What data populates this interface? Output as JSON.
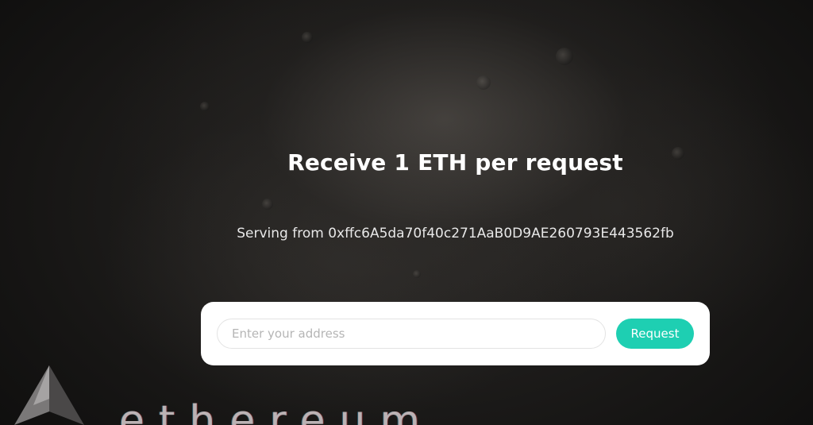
{
  "hero": {
    "title": "Receive 1 ETH per request",
    "serving_text": "Serving from 0xffc6A5da70f40c271AaB0D9AE260793E443562fb"
  },
  "form": {
    "address_placeholder": "Enter your address",
    "address_value": "",
    "request_label": "Request"
  },
  "branding": {
    "logo_icon": "ethereum-logo-icon",
    "wordmark": "ethereum"
  },
  "colors": {
    "accent": "#1ecfb2",
    "card_background": "#ffffff",
    "page_background": "#0b0b0b"
  }
}
